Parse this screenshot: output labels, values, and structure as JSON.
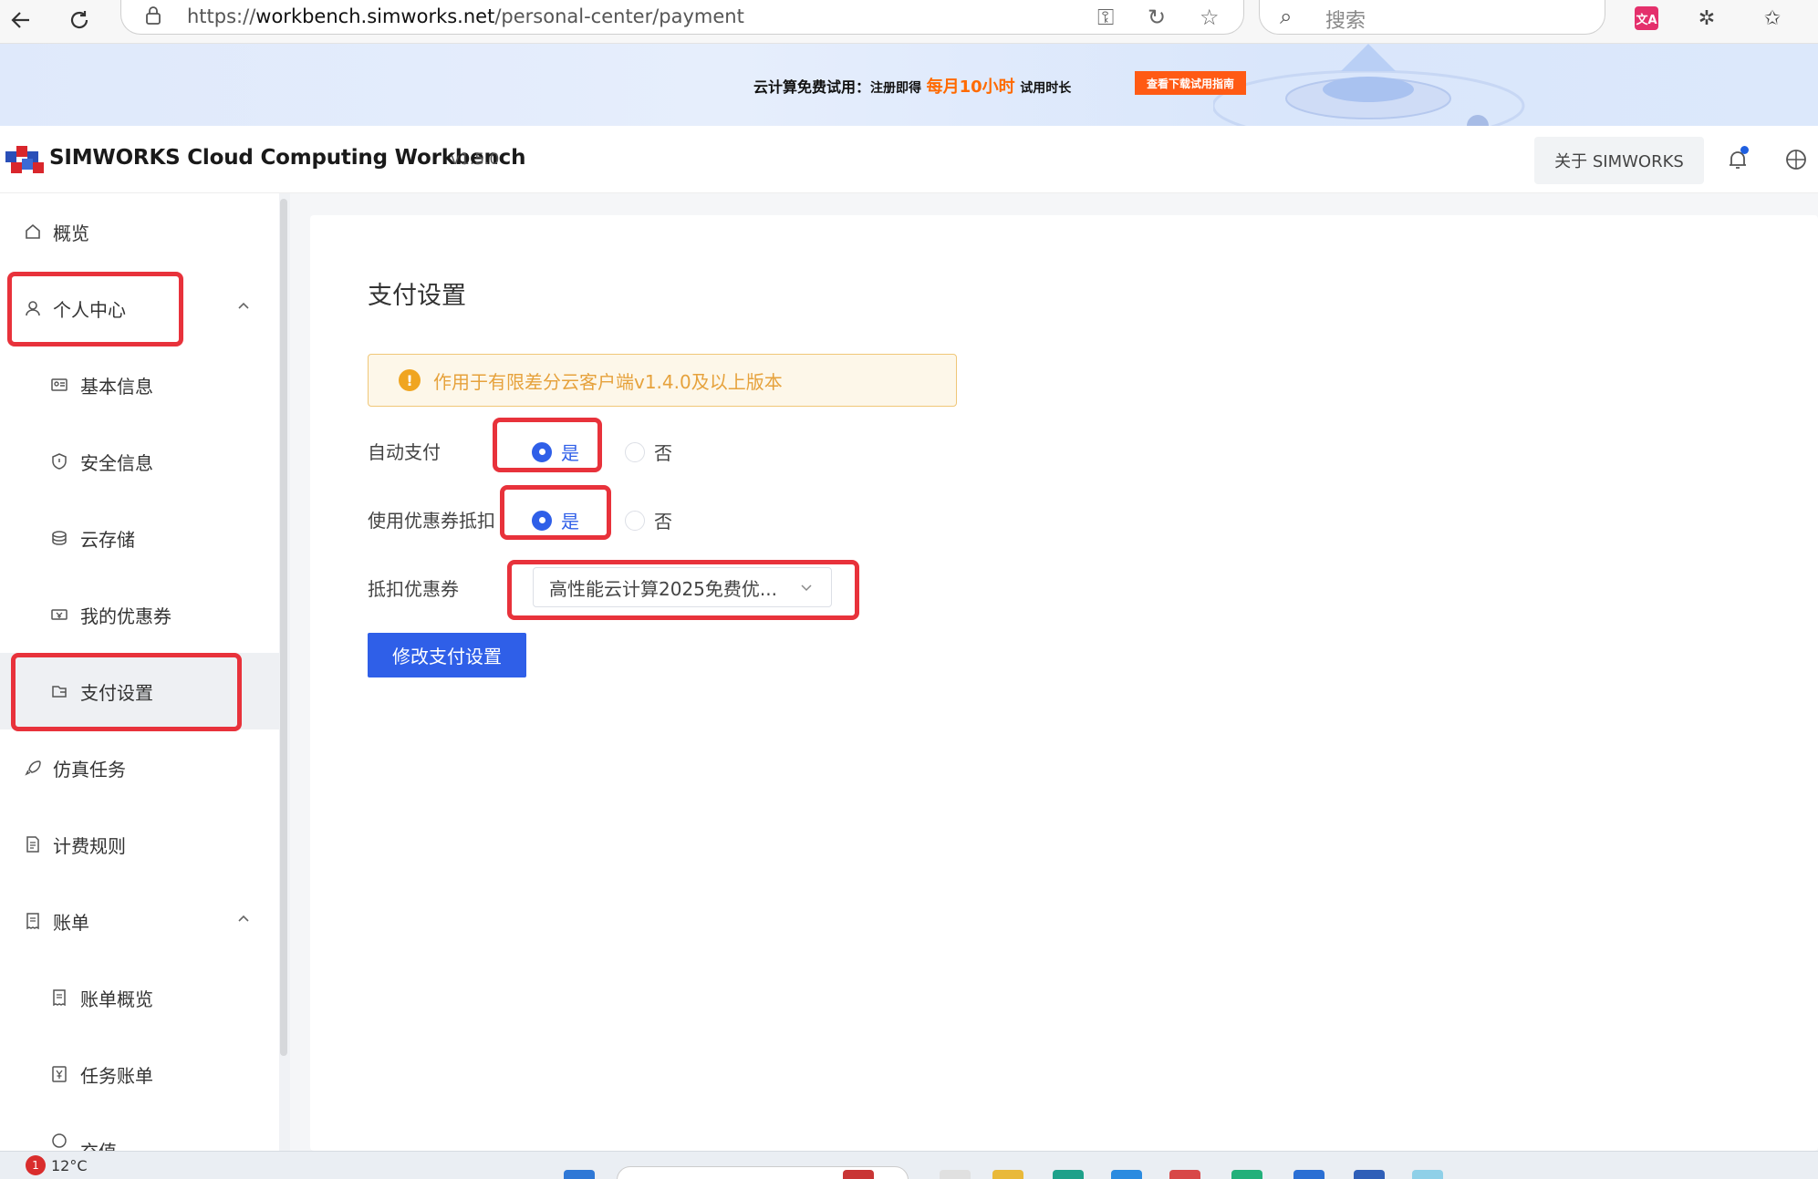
{
  "browser": {
    "url_scheme": "https://",
    "url_host": "workbench.simworks.net",
    "url_path": "/personal-center/payment",
    "search_placeholder": "搜索",
    "translate_ext": "文A"
  },
  "banner": {
    "text_prefix": "云计算免费试用：",
    "text_mid": "注册即得",
    "highlight": "每月10小时",
    "text_suffix": "试用时长",
    "button": "查看下载试用指南"
  },
  "header": {
    "brand": "SIMWORKS Cloud Computing Workbench",
    "version": "v1.5.0",
    "about_button": "关于 SIMWORKS"
  },
  "sidebar": {
    "items": [
      {
        "label": "概览",
        "icon": "home-icon"
      },
      {
        "label": "个人中心",
        "icon": "user-icon",
        "expanded": true
      },
      {
        "label": "基本信息",
        "icon": "id-card-icon"
      },
      {
        "label": "安全信息",
        "icon": "shield-icon"
      },
      {
        "label": "云存储",
        "icon": "cloud-storage-icon"
      },
      {
        "label": "我的优惠券",
        "icon": "ticket-icon"
      },
      {
        "label": "支付设置",
        "icon": "wallet-icon",
        "active": true
      },
      {
        "label": "仿真任务",
        "icon": "rocket-icon"
      },
      {
        "label": "计费规则",
        "icon": "document-icon"
      },
      {
        "label": "账单",
        "icon": "bill-icon",
        "expanded": true
      },
      {
        "label": "账单概览",
        "icon": "bill-icon"
      },
      {
        "label": "任务账单",
        "icon": "yen-doc-icon"
      },
      {
        "label": "充值",
        "icon": "recharge-icon"
      }
    ]
  },
  "content": {
    "title": "支付设置",
    "alert": "作用于有限差分云客户端v1.4.0及以上版本",
    "auto_pay_label": "自动支付",
    "coupon_use_label": "使用优惠券抵扣",
    "coupon_select_label": "抵扣优惠券",
    "yes": "是",
    "no": "否",
    "auto_pay_value": "是",
    "coupon_use_value": "是",
    "coupon_selected": "高性能云计算2025免费优...",
    "submit": "修改支付设置"
  },
  "taskbar": {
    "weather_badge": "1",
    "temperature": "12°C"
  },
  "colors": {
    "primary": "#2f5fe8",
    "highlight_red": "#e8323b",
    "warning": "#e6a23c",
    "banner_orange": "#ff5a14"
  }
}
